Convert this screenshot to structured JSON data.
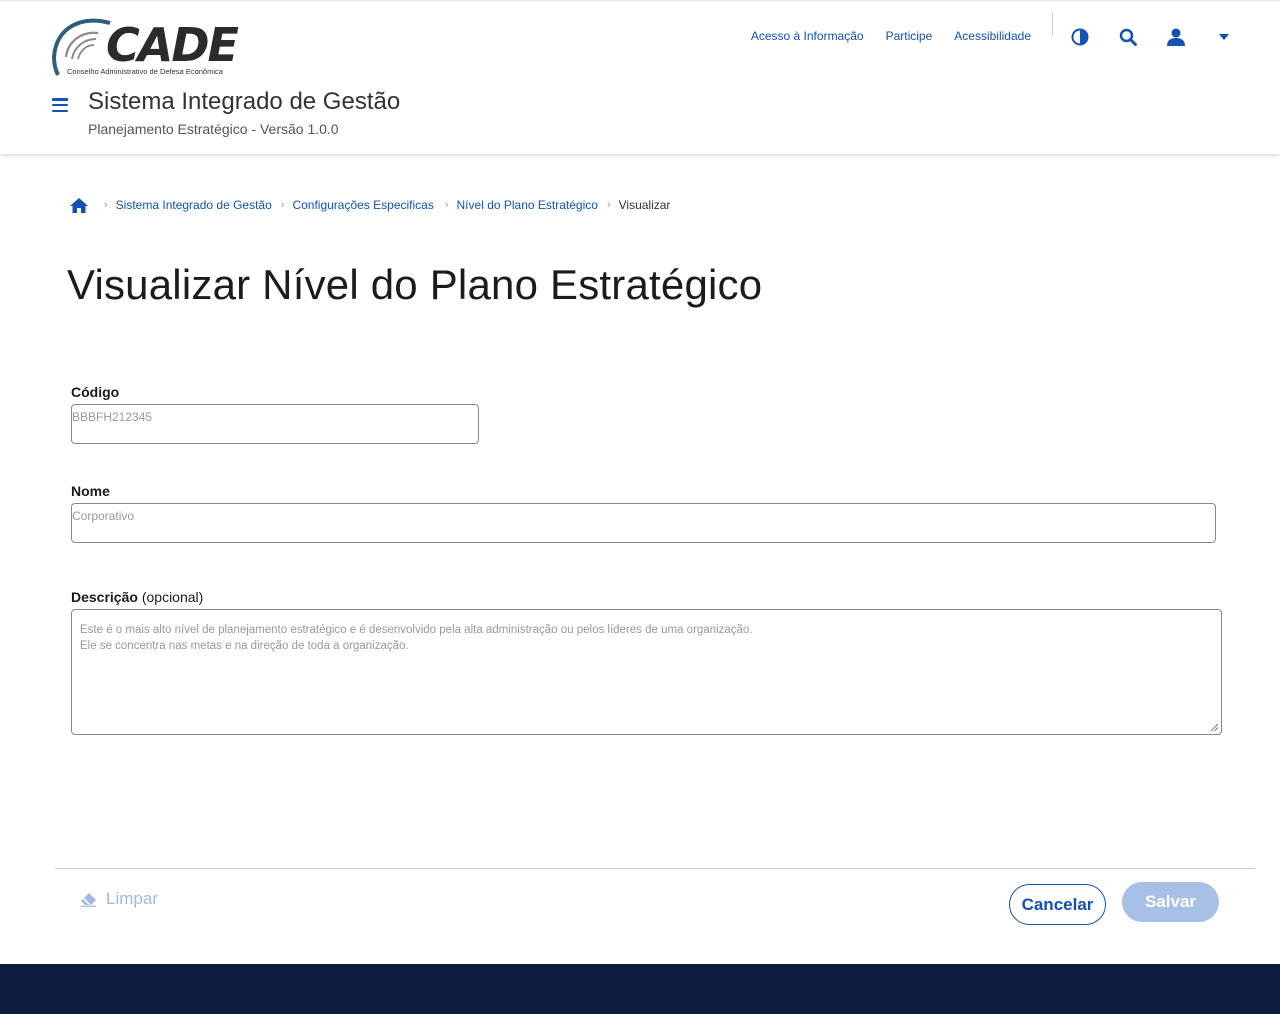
{
  "brand": {
    "logo_text": "CADE",
    "logo_subtitle": "Conselho Administrativo de Defesa Econômica"
  },
  "header": {
    "links": [
      "Acesso à Informação",
      "Participe",
      "Acessibilidade"
    ],
    "icons": [
      "contrast-icon",
      "search-icon",
      "user-icon",
      "caret-down-icon"
    ],
    "system_title": "Sistema Integrado de Gestão",
    "system_subtitle": "Planejamento Estratégico - Versão 1.0.0"
  },
  "breadcrumb": {
    "home_icon": "home-icon",
    "items": [
      "Sistema Integrado de Gestão",
      "Configurações Especificas",
      "Nível do Plano Estratégico"
    ],
    "current": "Visualizar"
  },
  "page": {
    "title": "Visualizar Nível do Plano Estratégico"
  },
  "form": {
    "codigo": {
      "label": "Código",
      "value": "BBBFH212345"
    },
    "nome": {
      "label": "Nome",
      "value": "Corporativo"
    },
    "descricao": {
      "label": "Descrição",
      "optional": "(opcional)",
      "line1": "Este é o mais alto nível de planejamento estratégico e é desenvolvido pela alta administração ou pelos líderes de uma organização.",
      "line2": "Ele se concentra nas metas e na direção de toda a organização."
    }
  },
  "actions": {
    "clear_label": "Limpar",
    "cancel_label": "Cancelar",
    "save_label": "Salvar"
  },
  "colors": {
    "primary": "#1351b4",
    "disabled": "#a8bfe6",
    "footer": "#0c1c41"
  }
}
